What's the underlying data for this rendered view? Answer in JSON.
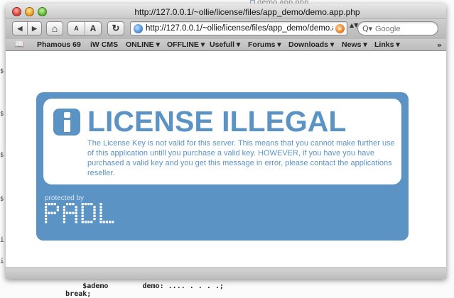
{
  "background": {
    "tab_label": "demo.app.php",
    "gutter_marks": [
      "$",
      "$",
      "$",
      "$",
      "i",
      "i"
    ],
    "code_lines": [
      "            $ademo        demo: .... . . . .;",
      "        break;"
    ]
  },
  "window": {
    "title": "http://127.0.0.1/~ollie/license/files/app_demo/demo.app.php"
  },
  "toolbar": {
    "back_glyph": "◀",
    "forward_glyph": "▶",
    "home_glyph": "⌂",
    "text_smaller_label": "A",
    "text_larger_label": "A",
    "reload_glyph": "↻",
    "address": "http://127.0.0.1/~ollie/license/files/app_demo/demo.app.php",
    "rss_glyph": "»",
    "address_menu_glyph": "▲▼",
    "search_icon_glyph": "Q▾",
    "search_placeholder": "Google"
  },
  "bookmarks": {
    "icon_glyph": "📖",
    "items": [
      {
        "label": "Phamous 69"
      },
      {
        "label": "iW CMS"
      },
      {
        "label": "ONLINE ▾"
      },
      {
        "label": "OFFLINE ▾"
      },
      {
        "label": "Usefull ▾"
      },
      {
        "label": "Forums ▾"
      },
      {
        "label": "Downloads ▾"
      },
      {
        "label": "News ▾"
      },
      {
        "label": "Links ▾"
      }
    ],
    "overflow_glyph": "»"
  },
  "license": {
    "title": "LICENSE ILLEGAL",
    "message": "The License Key is not valid for this server. This means that you cannot make further use of this application untill you purchase a valid key. HOWEVER, if you have you have purchased a valid key and you get this message in error, please contact the applications reseller.",
    "protected_by": "protected by",
    "logo_text": "PADL",
    "accent_color": "#5c93c5"
  }
}
